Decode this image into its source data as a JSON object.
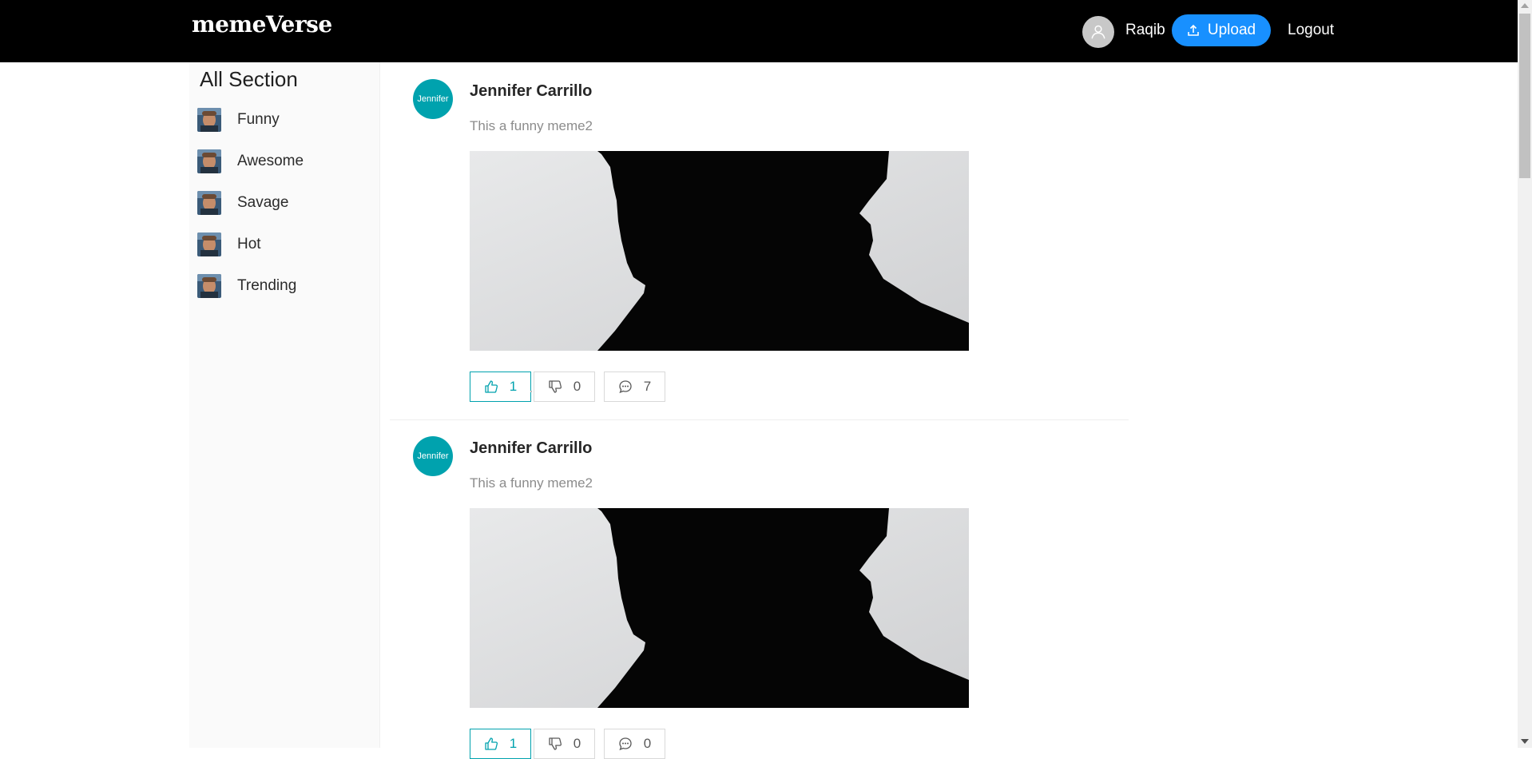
{
  "header": {
    "logo": "memeVerse",
    "user_name": "Raqib",
    "upload_label": "Upload",
    "logout_label": "Logout",
    "brand_color": "#1890ff"
  },
  "sidebar": {
    "title": "All Section",
    "items": [
      {
        "label": "Funny",
        "icon": "meme-thumbnail"
      },
      {
        "label": "Awesome",
        "icon": "meme-thumbnail"
      },
      {
        "label": "Savage",
        "icon": "meme-thumbnail"
      },
      {
        "label": "Hot",
        "icon": "meme-thumbnail"
      },
      {
        "label": "Trending",
        "icon": "meme-thumbnail"
      }
    ]
  },
  "posts": [
    {
      "avatar_text": "Jennifer",
      "author": "Jennifer Carrillo",
      "caption": "This a funny meme2",
      "likes": "1",
      "dislikes": "0",
      "comments": "7"
    },
    {
      "avatar_text": "Jennifer",
      "author": "Jennifer Carrillo",
      "caption": "This a funny meme2",
      "likes": "1",
      "dislikes": "0",
      "comments": "0"
    }
  ],
  "colors": {
    "accent": "#00a2ae",
    "header_bg": "#000000"
  }
}
